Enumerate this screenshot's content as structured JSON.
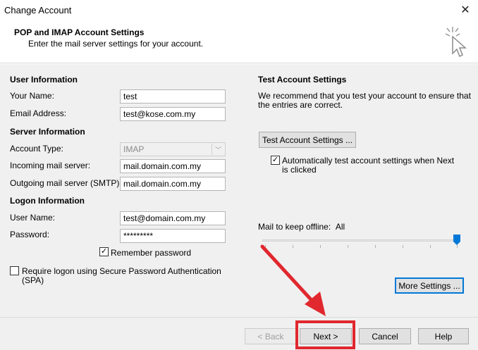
{
  "window": {
    "title": "Change Account"
  },
  "header": {
    "title": "POP and IMAP Account Settings",
    "subtitle": "Enter the mail server settings for your account."
  },
  "user_info": {
    "heading": "User Information",
    "your_name_label": "Your Name:",
    "your_name_value": "test",
    "email_label": "Email Address:",
    "email_value": "test@kose.com.my"
  },
  "server_info": {
    "heading": "Server Information",
    "account_type_label": "Account Type:",
    "account_type_value": "IMAP",
    "incoming_label": "Incoming mail server:",
    "incoming_value": "mail.domain.com.my",
    "outgoing_label": "Outgoing mail server (SMTP):",
    "outgoing_value": "mail.domain.com.my"
  },
  "logon_info": {
    "heading": "Logon Information",
    "username_label": "User Name:",
    "username_value": "test@domain.com.my",
    "password_label": "Password:",
    "password_value": "*********",
    "remember_label": "Remember password",
    "remember_checked": true,
    "spa_label_line1": "Require logon using Secure Password Authentication",
    "spa_label_line2": "(SPA)",
    "spa_checked": false
  },
  "test_settings": {
    "heading": "Test Account Settings",
    "description_line1": "We recommend that you test your account to ensure that",
    "description_line2": "the entries are correct.",
    "test_button": "Test Account Settings ...",
    "auto_test_line1": "Automatically test account settings when Next",
    "auto_test_line2": "is clicked",
    "auto_test_checked": true
  },
  "offline": {
    "label": "Mail to keep offline:",
    "value": "All",
    "slider_level": 1.0
  },
  "more_settings_button": "More Settings ...",
  "footer": {
    "back": "< Back",
    "next": "Next >",
    "cancel": "Cancel",
    "help": "Help"
  },
  "icons": {
    "close": "close-icon",
    "cursor": "click-cursor-icon",
    "check": "✓",
    "dropdown": "chevron-down-icon"
  },
  "colors": {
    "annotation_red": "#e0282e",
    "focus_blue": "#0078d7",
    "slider_thumb": "#0078d7"
  }
}
